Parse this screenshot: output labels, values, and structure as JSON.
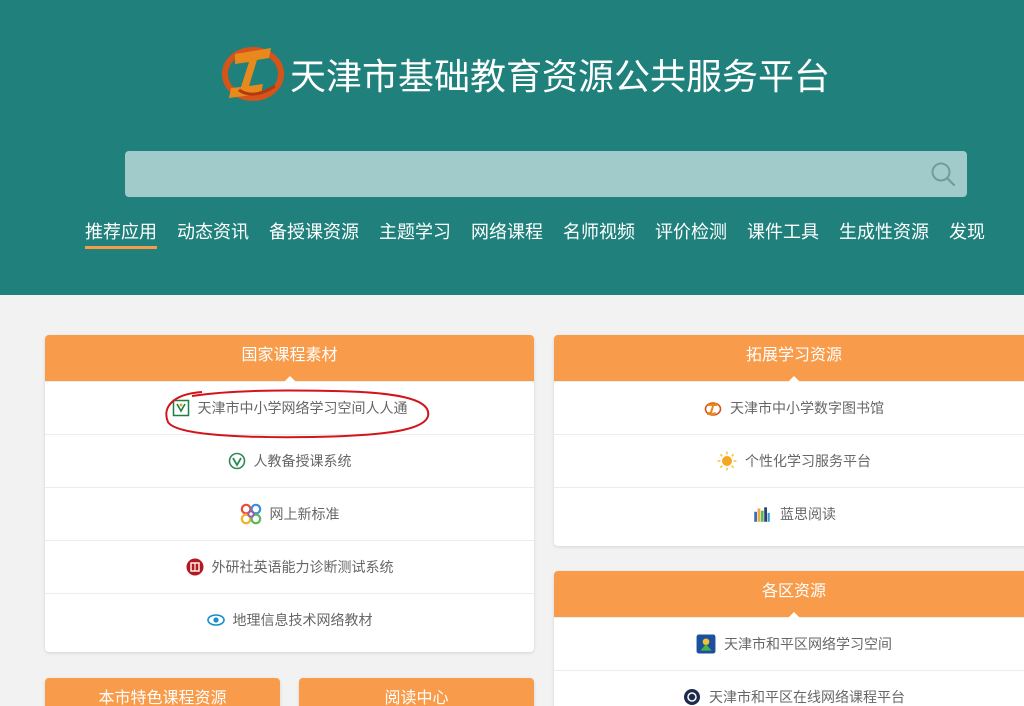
{
  "site": {
    "title": "天津市基础教育资源公共服务平台"
  },
  "search": {
    "placeholder": ""
  },
  "nav": [
    {
      "label": "推荐应用",
      "active": true
    },
    {
      "label": "动态资讯"
    },
    {
      "label": "备授课资源"
    },
    {
      "label": "主题学习"
    },
    {
      "label": "网络课程"
    },
    {
      "label": "名师视频"
    },
    {
      "label": "评价检测"
    },
    {
      "label": "课件工具"
    },
    {
      "label": "生成性资源"
    },
    {
      "label": "发现"
    }
  ],
  "cards": {
    "national": {
      "title": "国家课程素材",
      "items": [
        {
          "label": "天津市中小学网络学习空间人人通",
          "icon": "space-icon"
        },
        {
          "label": "人教备授课系统",
          "icon": "pep-icon"
        },
        {
          "label": "网上新标准",
          "icon": "rings-icon"
        },
        {
          "label": "外研社英语能力诊断测试系统",
          "icon": "fltrp-icon"
        },
        {
          "label": "地理信息技术网络教材",
          "icon": "eye-icon"
        }
      ]
    },
    "extended": {
      "title": "拓展学习资源",
      "items": [
        {
          "label": "天津市中小学数字图书馆",
          "icon": "library-icon"
        },
        {
          "label": "个性化学习服务平台",
          "icon": "sun-icon"
        },
        {
          "label": "蓝思阅读",
          "icon": "books-icon"
        }
      ]
    },
    "district": {
      "title": "各区资源",
      "items": [
        {
          "label": "天津市和平区网络学习空间",
          "icon": "heping-icon"
        },
        {
          "label": "天津市和平区在线网络课程平台",
          "icon": "online-course-icon"
        }
      ]
    },
    "local": {
      "title": "本市特色课程资源"
    },
    "reading": {
      "title": "阅读中心"
    }
  },
  "colors": {
    "header_bg": "#1f807c",
    "accent": "#f89c4b",
    "search_bg": "#a0cbca"
  }
}
